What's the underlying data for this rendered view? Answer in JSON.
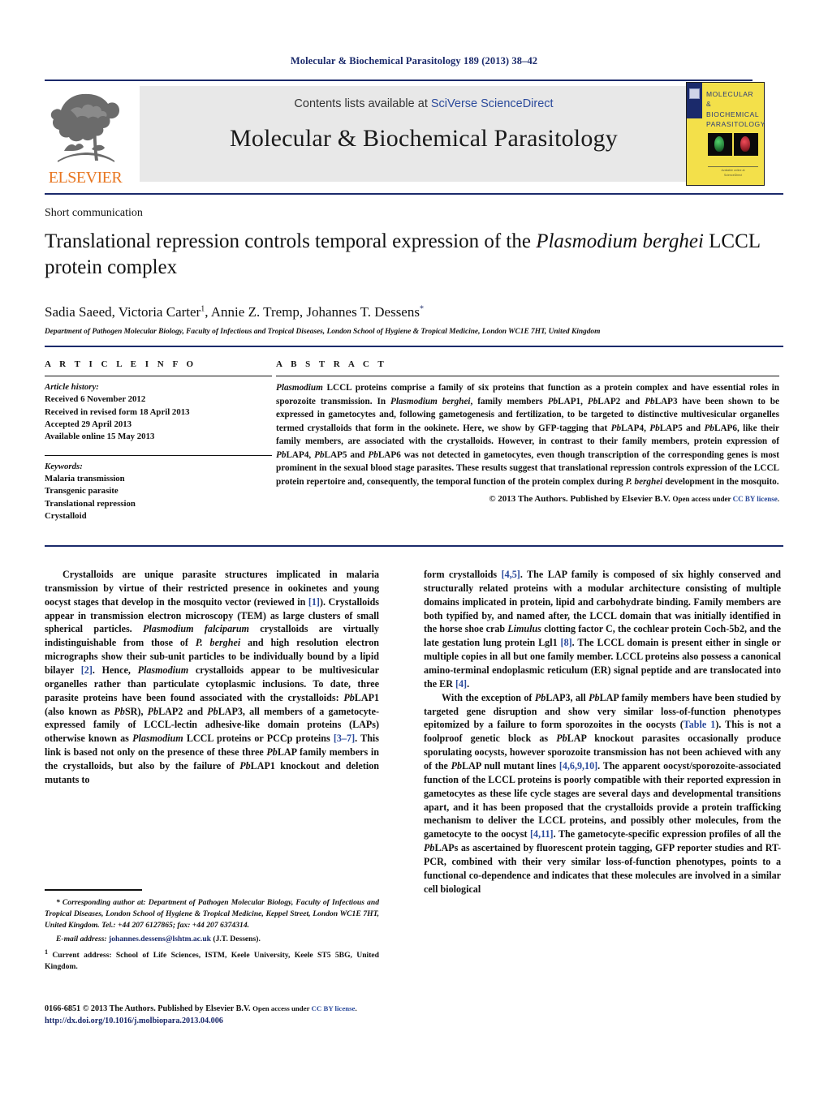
{
  "running_head": "Molecular & Biochemical Parasitology 189 (2013) 38–42",
  "masthead": {
    "contents_prefix": "Contents lists available at ",
    "contents_link": "SciVerse ScienceDirect",
    "journal_title": "Molecular & Biochemical Parasitology",
    "publisher_wordmark": "ELSEVIER",
    "publisher_logo_icon": "elsevier-tree-icon",
    "cover": {
      "title_line1": "MOLECULAR",
      "title_line2": "& BIOCHEMICAL",
      "title_line3": "PARASITOLOGY",
      "footer_line1": "Available online at",
      "footer_line2": "ScienceDirect"
    }
  },
  "article": {
    "doc_type": "Short communication",
    "title_part1": "Translational repression controls temporal expression of the ",
    "title_italic": "Plasmodium berghei",
    "title_part2": " LCCL protein complex",
    "authors_plain_1": "Sadia Saeed, Victoria Carter",
    "authors_sup_1": "1",
    "authors_plain_2": ", Annie Z. Tremp, Johannes T. Dessens",
    "authors_star": "*",
    "affiliation": "Department of Pathogen Molecular Biology, Faculty of Infectious and Tropical Diseases, London School of Hygiene & Tropical Medicine, London WC1E 7HT, United Kingdom"
  },
  "article_info": {
    "heading": "A R T I C L E   I N F O",
    "history_title": "Article history:",
    "history": [
      "Received 6 November 2012",
      "Received in revised form 18 April 2013",
      "Accepted 29 April 2013",
      "Available online 15 May 2013"
    ],
    "keywords_title": "Keywords:",
    "keywords": [
      "Malaria transmission",
      "Transgenic parasite",
      "Translational repression",
      "Crystalloid"
    ]
  },
  "abstract": {
    "heading": "A B S T R A C T",
    "body_html": "<i>Plasmodium</i> LCCL proteins comprise a family of six proteins that function as a protein complex and have essential roles in sporozoite transmission. In <i>Plasmodium berghei</i>, family members <i>Pb</i>LAP1, <i>Pb</i>LAP2 and <i>Pb</i>LAP3 have been shown to be expressed in gametocytes and, following gametogenesis and fertilization, to be targeted to distinctive multivesicular organelles termed crystalloids that form in the ookinete. Here, we show by GFP-tagging that <i>Pb</i>LAP4, <i>Pb</i>LAP5 and <i>Pb</i>LAP6, like their family members, are associated with the crystalloids. However, in contrast to their family members, protein expression of <i>Pb</i>LAP4, <i>Pb</i>LAP5 and <i>Pb</i>LAP6 was not detected in gametocytes, even though transcription of the corresponding genes is most prominent in the sexual blood stage parasites. These results suggest that translational repression controls expression of the LCCL protein repertoire and, consequently, the temporal function of the protein complex during <i>P. berghei</i> development in the mosquito.",
    "copyright": "© 2013 The Authors. Published by Elsevier B.V.",
    "open_access_prefix": "Open access under ",
    "open_access_link": "CC BY license",
    "open_access_suffix": "."
  },
  "body": {
    "left_column_html": "<p>Crystalloids are unique parasite structures implicated in malaria transmission by virtue of their restricted presence in ookinetes and young oocyst stages that develop in the mosquito vector (reviewed in <span class=\"ref\">[1]</span>). Crystalloids appear in transmission electron microscopy (TEM) as large clusters of small spherical particles. <i>Plasmodium falciparum</i> crystalloids are virtually indistinguishable from those of <i>P. berghei</i> and high resolution electron micrographs show their sub-unit particles to be individually bound by a lipid bilayer <span class=\"ref\">[2]</span>. Hence, <i>Plasmodium</i> crystalloids appear to be multivesicular organelles rather than particulate cytoplasmic inclusions. To date, three parasite proteins have been found associated with the crystalloids: <i>Pb</i>LAP1 (also known as <i>Pb</i>SR), <i>Pb</i>LAP2 and <i>Pb</i>LAP3, all members of a gametocyte-expressed family of LCCL-lectin adhesive-like domain proteins (LAPs) otherwise known as <i>Plasmodium</i> LCCL proteins or PCCp proteins <span class=\"ref\">[3–7]</span>. This link is based not only on the presence of these three <i>Pb</i>LAP family members in the crystalloids, but also by the failure of <i>Pb</i>LAP1 knockout and deletion mutants to</p>",
    "right_column_html": "<p style=\"text-indent:0\">form crystalloids <span class=\"ref\">[4,5]</span>. The LAP family is composed of six highly conserved and structurally related proteins with a modular architecture consisting of multiple domains implicated in protein, lipid and carbohydrate binding. Family members are both typified by, and named after, the LCCL domain that was initially identified in the horse shoe crab <i>Limulus</i> clotting factor C, the cochlear protein Coch-5b2, and the late gestation lung protein Lgl1 <span class=\"ref\">[8]</span>. The LCCL domain is present either in single or multiple copies in all but one family member. LCCL proteins also possess a canonical amino-terminal endoplasmic reticulum (ER) signal peptide and are translocated into the ER <span class=\"ref\">[4]</span>.</p><p>With the exception of <i>Pb</i>LAP3, all <i>Pb</i>LAP family members have been studied by targeted gene disruption and show very similar loss-of-function phenotypes epitomized by a failure to form sporozoites in the oocysts (<span class=\"ref\">Table 1</span>). This is not a foolproof genetic block as <i>Pb</i>LAP knockout parasites occasionally produce sporulating oocysts, however sporozoite transmission has not been achieved with any of the <i>Pb</i>LAP null mutant lines <span class=\"ref\">[4,6,9,10]</span>. The apparent oocyst/sporozoite-associated function of the LCCL proteins is poorly compatible with their reported expression in gametocytes as these life cycle stages are several days and developmental transitions apart, and it has been proposed that the crystalloids provide a protein trafficking mechanism to deliver the LCCL proteins, and possibly other molecules, from the gametocyte to the oocyst <span class=\"ref\">[4,11]</span>. The gametocyte-specific expression profiles of all the <i>Pb</i>LAPs as ascertained by fluorescent protein tagging, GFP reporter studies and RT-PCR, combined with their very similar loss-of-function phenotypes, points to a functional co-dependence and indicates that these molecules are involved in a similar cell biological</p>"
  },
  "footnotes": {
    "corresponding_html": "<span style=\"font-style:italic\">* Corresponding author at: Department of Pathogen Molecular Biology, Faculty of Infectious and Tropical Diseases, London School of Hygiene &amp; Tropical Medicine, Keppel Street, London WC1E 7HT, United Kingdom. Tel.: +44 207 6127865; fax: +44 207 6374314.</span>",
    "email_label": "E-mail address:",
    "email_link": "johannes.dessens@lshtm.ac.uk",
    "email_suffix": " (J.T. Dessens).",
    "current_address_sup": "1",
    "current_address": " Current address: School of Life Sciences, ISTM, Keele University, Keele ST5 5BG, United Kingdom."
  },
  "page_footer": {
    "issn_copyright": "0166-6851 © 2013 The Authors. Published by Elsevier B.V.",
    "open_access_prefix": "Open access under ",
    "open_access_link": "CC BY license",
    "open_access_suffix": ".",
    "doi": "http://dx.doi.org/10.1016/j.molbiopara.2013.04.006"
  },
  "colors": {
    "brand_blue": "#1b2a6b",
    "link_blue": "#2b4a9b",
    "elsevier_orange": "#e87722",
    "band_gray": "#e8e8e8",
    "cover_yellow": "#f3e04a"
  }
}
